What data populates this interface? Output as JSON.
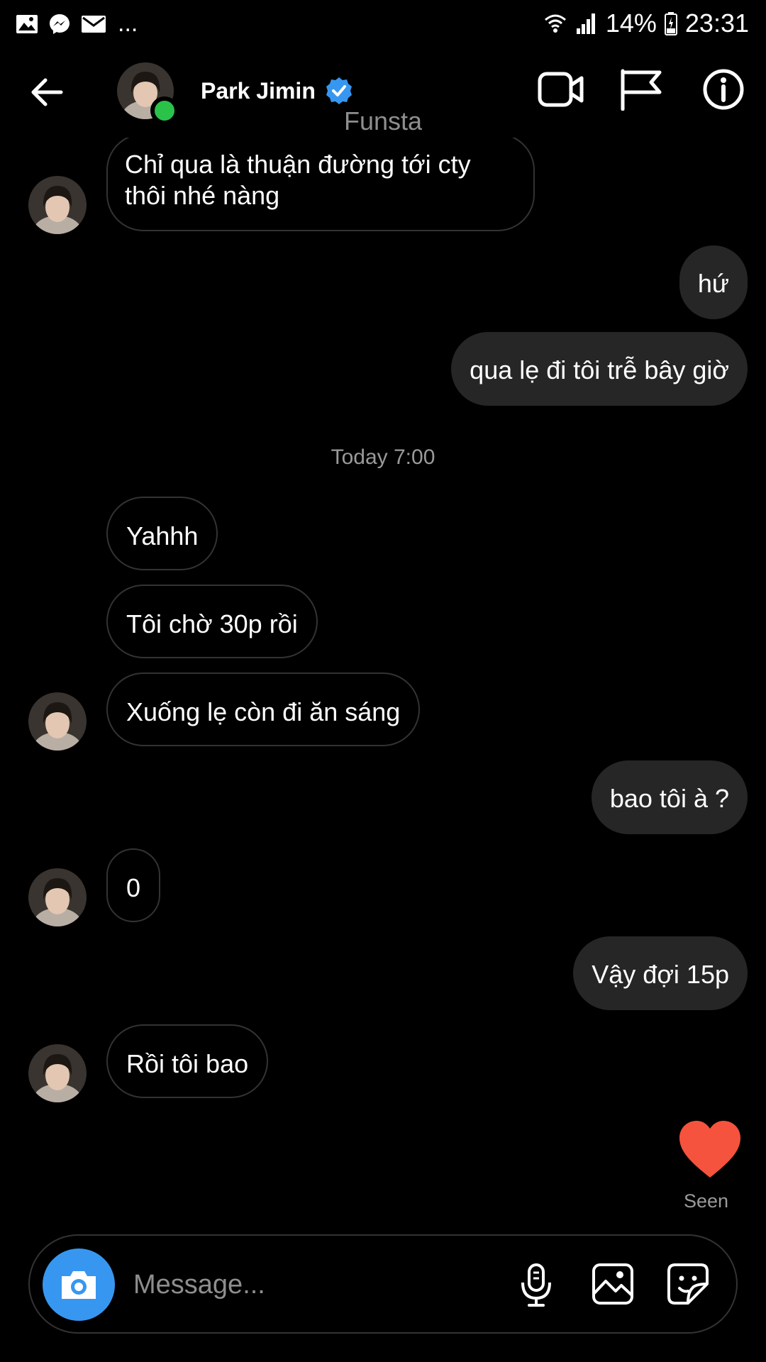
{
  "status_bar": {
    "battery": "14%",
    "time": "23:31",
    "overflow": "...",
    "left_icons": [
      "gallery-notification-icon",
      "messenger-notification-icon",
      "mail-notification-icon"
    ],
    "right_icons": [
      "wifi-icon",
      "signal-icon",
      "battery-icon"
    ]
  },
  "header": {
    "name": "Park Jimin",
    "subtitle": "Funsta",
    "online": true,
    "verified": true
  },
  "conversation": {
    "timestamp": "Today 7:00",
    "messages": [
      {
        "from": "them",
        "text_lines": [
          "Chỉ qua là thuận đường tới cty",
          "thôi nhé nàng"
        ]
      },
      {
        "from": "me",
        "text": "hứ"
      },
      {
        "from": "me",
        "text": "qua lẹ đi tôi trễ bây giờ"
      },
      {
        "from": "them",
        "text": "Yahhh"
      },
      {
        "from": "them",
        "text": "Tôi chờ 30p rồi"
      },
      {
        "from": "them",
        "text": "Xuống lẹ còn đi ăn sáng"
      },
      {
        "from": "me",
        "text": "bao tôi à ?"
      },
      {
        "from": "them",
        "text": "0"
      },
      {
        "from": "me",
        "text": "Vậy đợi 15p"
      },
      {
        "from": "them",
        "text": "Rồi tôi bao"
      }
    ],
    "reaction": "heart",
    "seen_label": "Seen"
  },
  "composer": {
    "placeholder": "Message..."
  },
  "colors": {
    "background": "#000000",
    "outgoing_bubble": "#262626",
    "incoming_border": "#333333",
    "camera_button": "#3797f0",
    "online_dot": "#2bc24a",
    "verified_badge": "#3797f0",
    "heart": "#f5533d"
  }
}
